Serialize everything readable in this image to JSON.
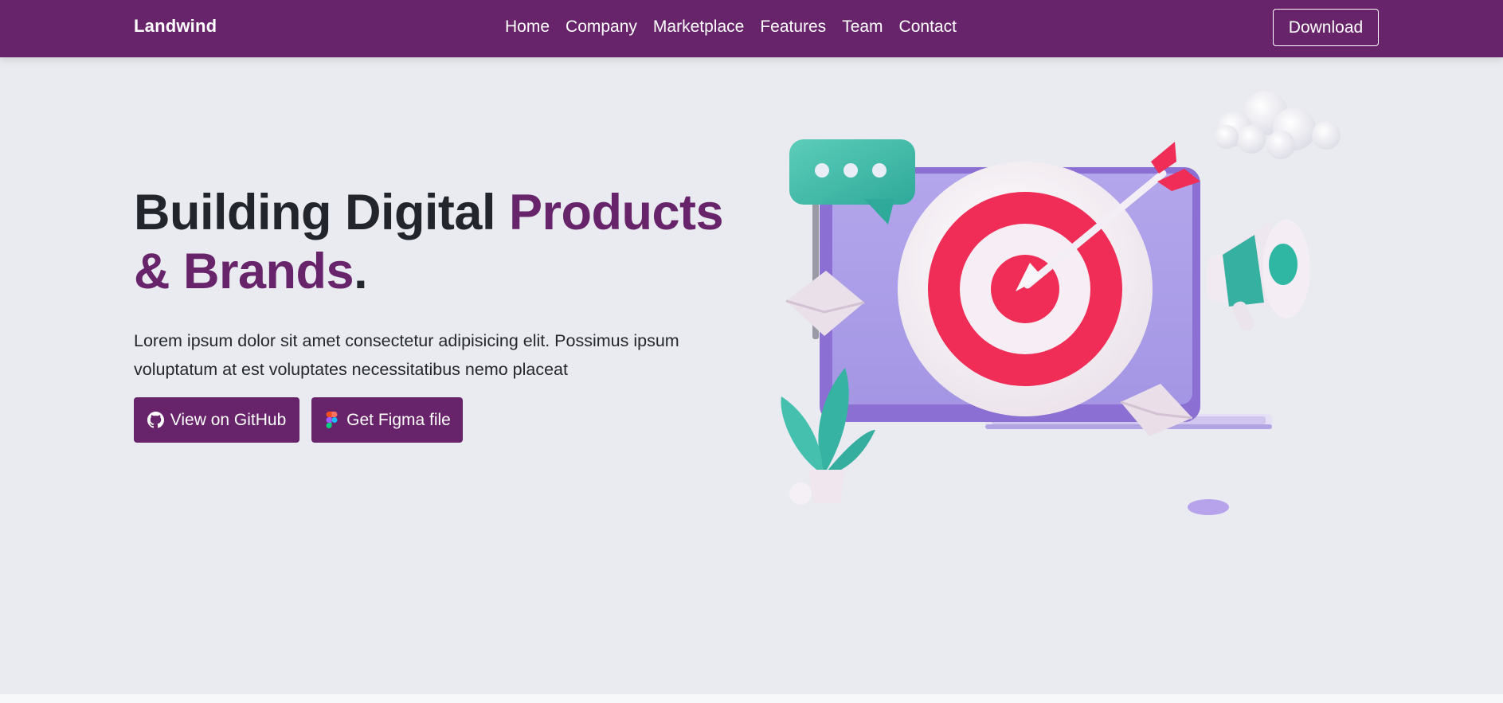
{
  "nav": {
    "brand": "Landwind",
    "links": [
      "Home",
      "Company",
      "Marketplace",
      "Features",
      "Team",
      "Contact"
    ],
    "download_label": "Download"
  },
  "hero": {
    "title_part1": "Building Digital ",
    "title_accent": "Products & Brands",
    "title_end": ".",
    "description": "Lorem ipsum dolor sit amet consectetur adipisicing elit. Possimus ipsum voluptatum at est voluptates necessitatibus nemo placeat",
    "github_label": "View on GitHub",
    "figma_label": "Get Figma file"
  },
  "colors": {
    "primary": "#68246a",
    "background": "#e9ebf0",
    "heading": "#22252b"
  },
  "icons": {
    "github": "github-icon",
    "figma": "figma-icon"
  }
}
